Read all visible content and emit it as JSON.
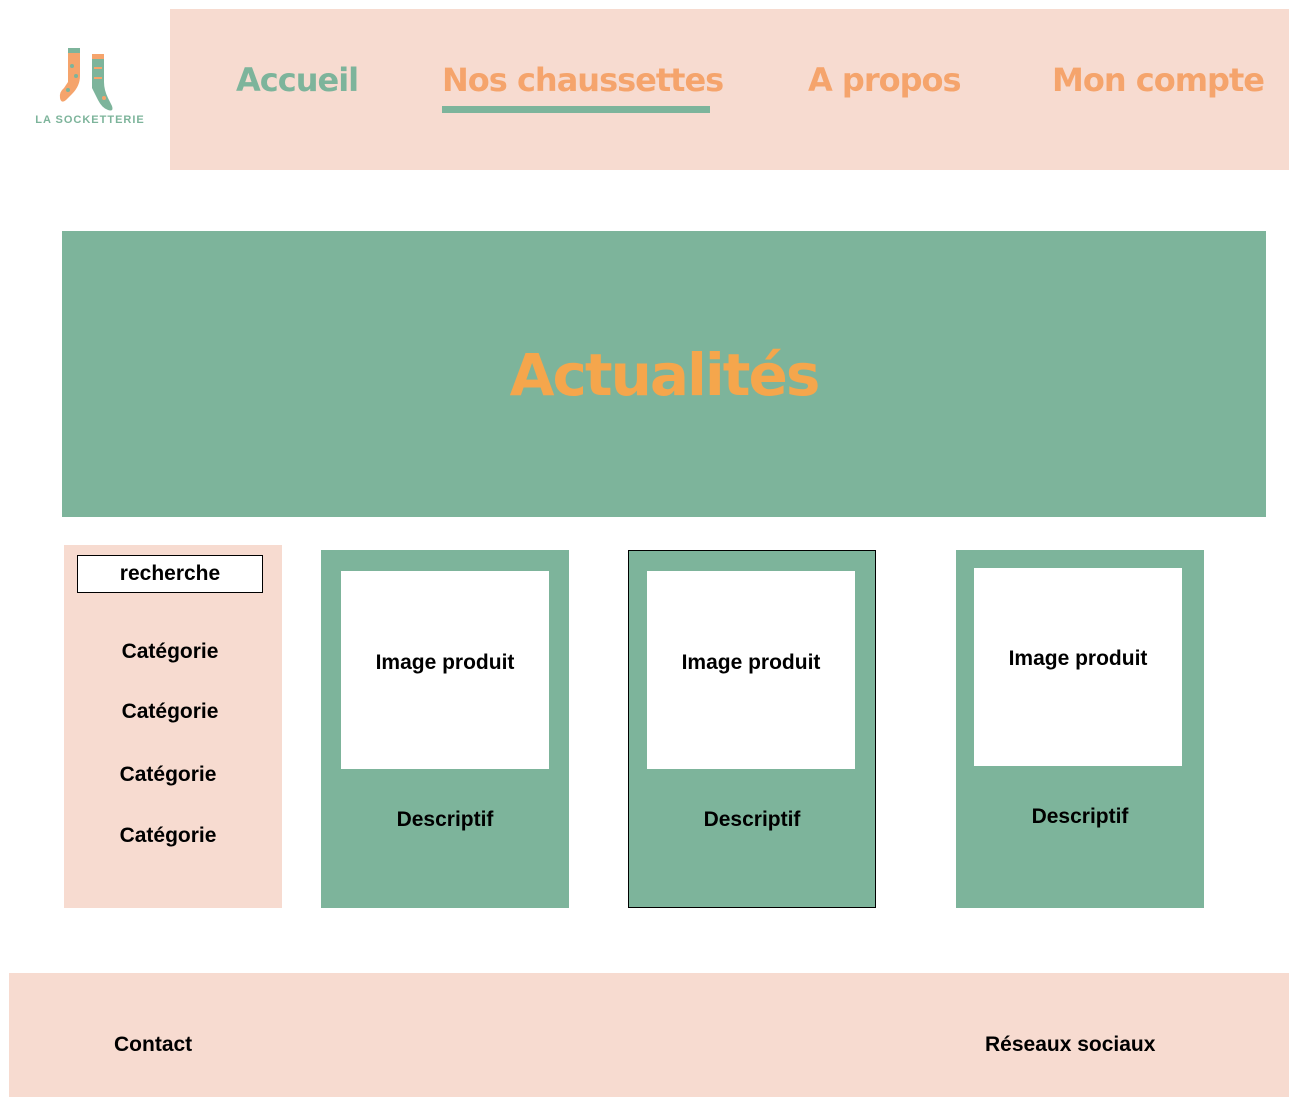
{
  "brand": {
    "name": "LA SOCKETTERIE",
    "logo_icon": "socks-icon",
    "colors": {
      "green": "#7db49b",
      "pink": "#f7dbd0",
      "orange": "#f5a46c",
      "hero_orange": "#f5a64c"
    }
  },
  "nav": {
    "items": [
      {
        "label": "Accueil"
      },
      {
        "label": "Nos chaussettes",
        "active": true
      },
      {
        "label": "A propos"
      },
      {
        "label": "Mon compte"
      }
    ]
  },
  "hero": {
    "title": "Actualités"
  },
  "sidebar": {
    "search_label": "recherche",
    "categories": [
      "Catégorie",
      "Catégorie",
      "Catégorie",
      "Catégorie"
    ]
  },
  "products": [
    {
      "image_label": "Image produit",
      "description": "Descriptif"
    },
    {
      "image_label": "Image produit",
      "description": "Descriptif"
    },
    {
      "image_label": "Image produit",
      "description": "Descriptif"
    }
  ],
  "footer": {
    "contact": "Contact",
    "social": "Réseaux sociaux"
  }
}
